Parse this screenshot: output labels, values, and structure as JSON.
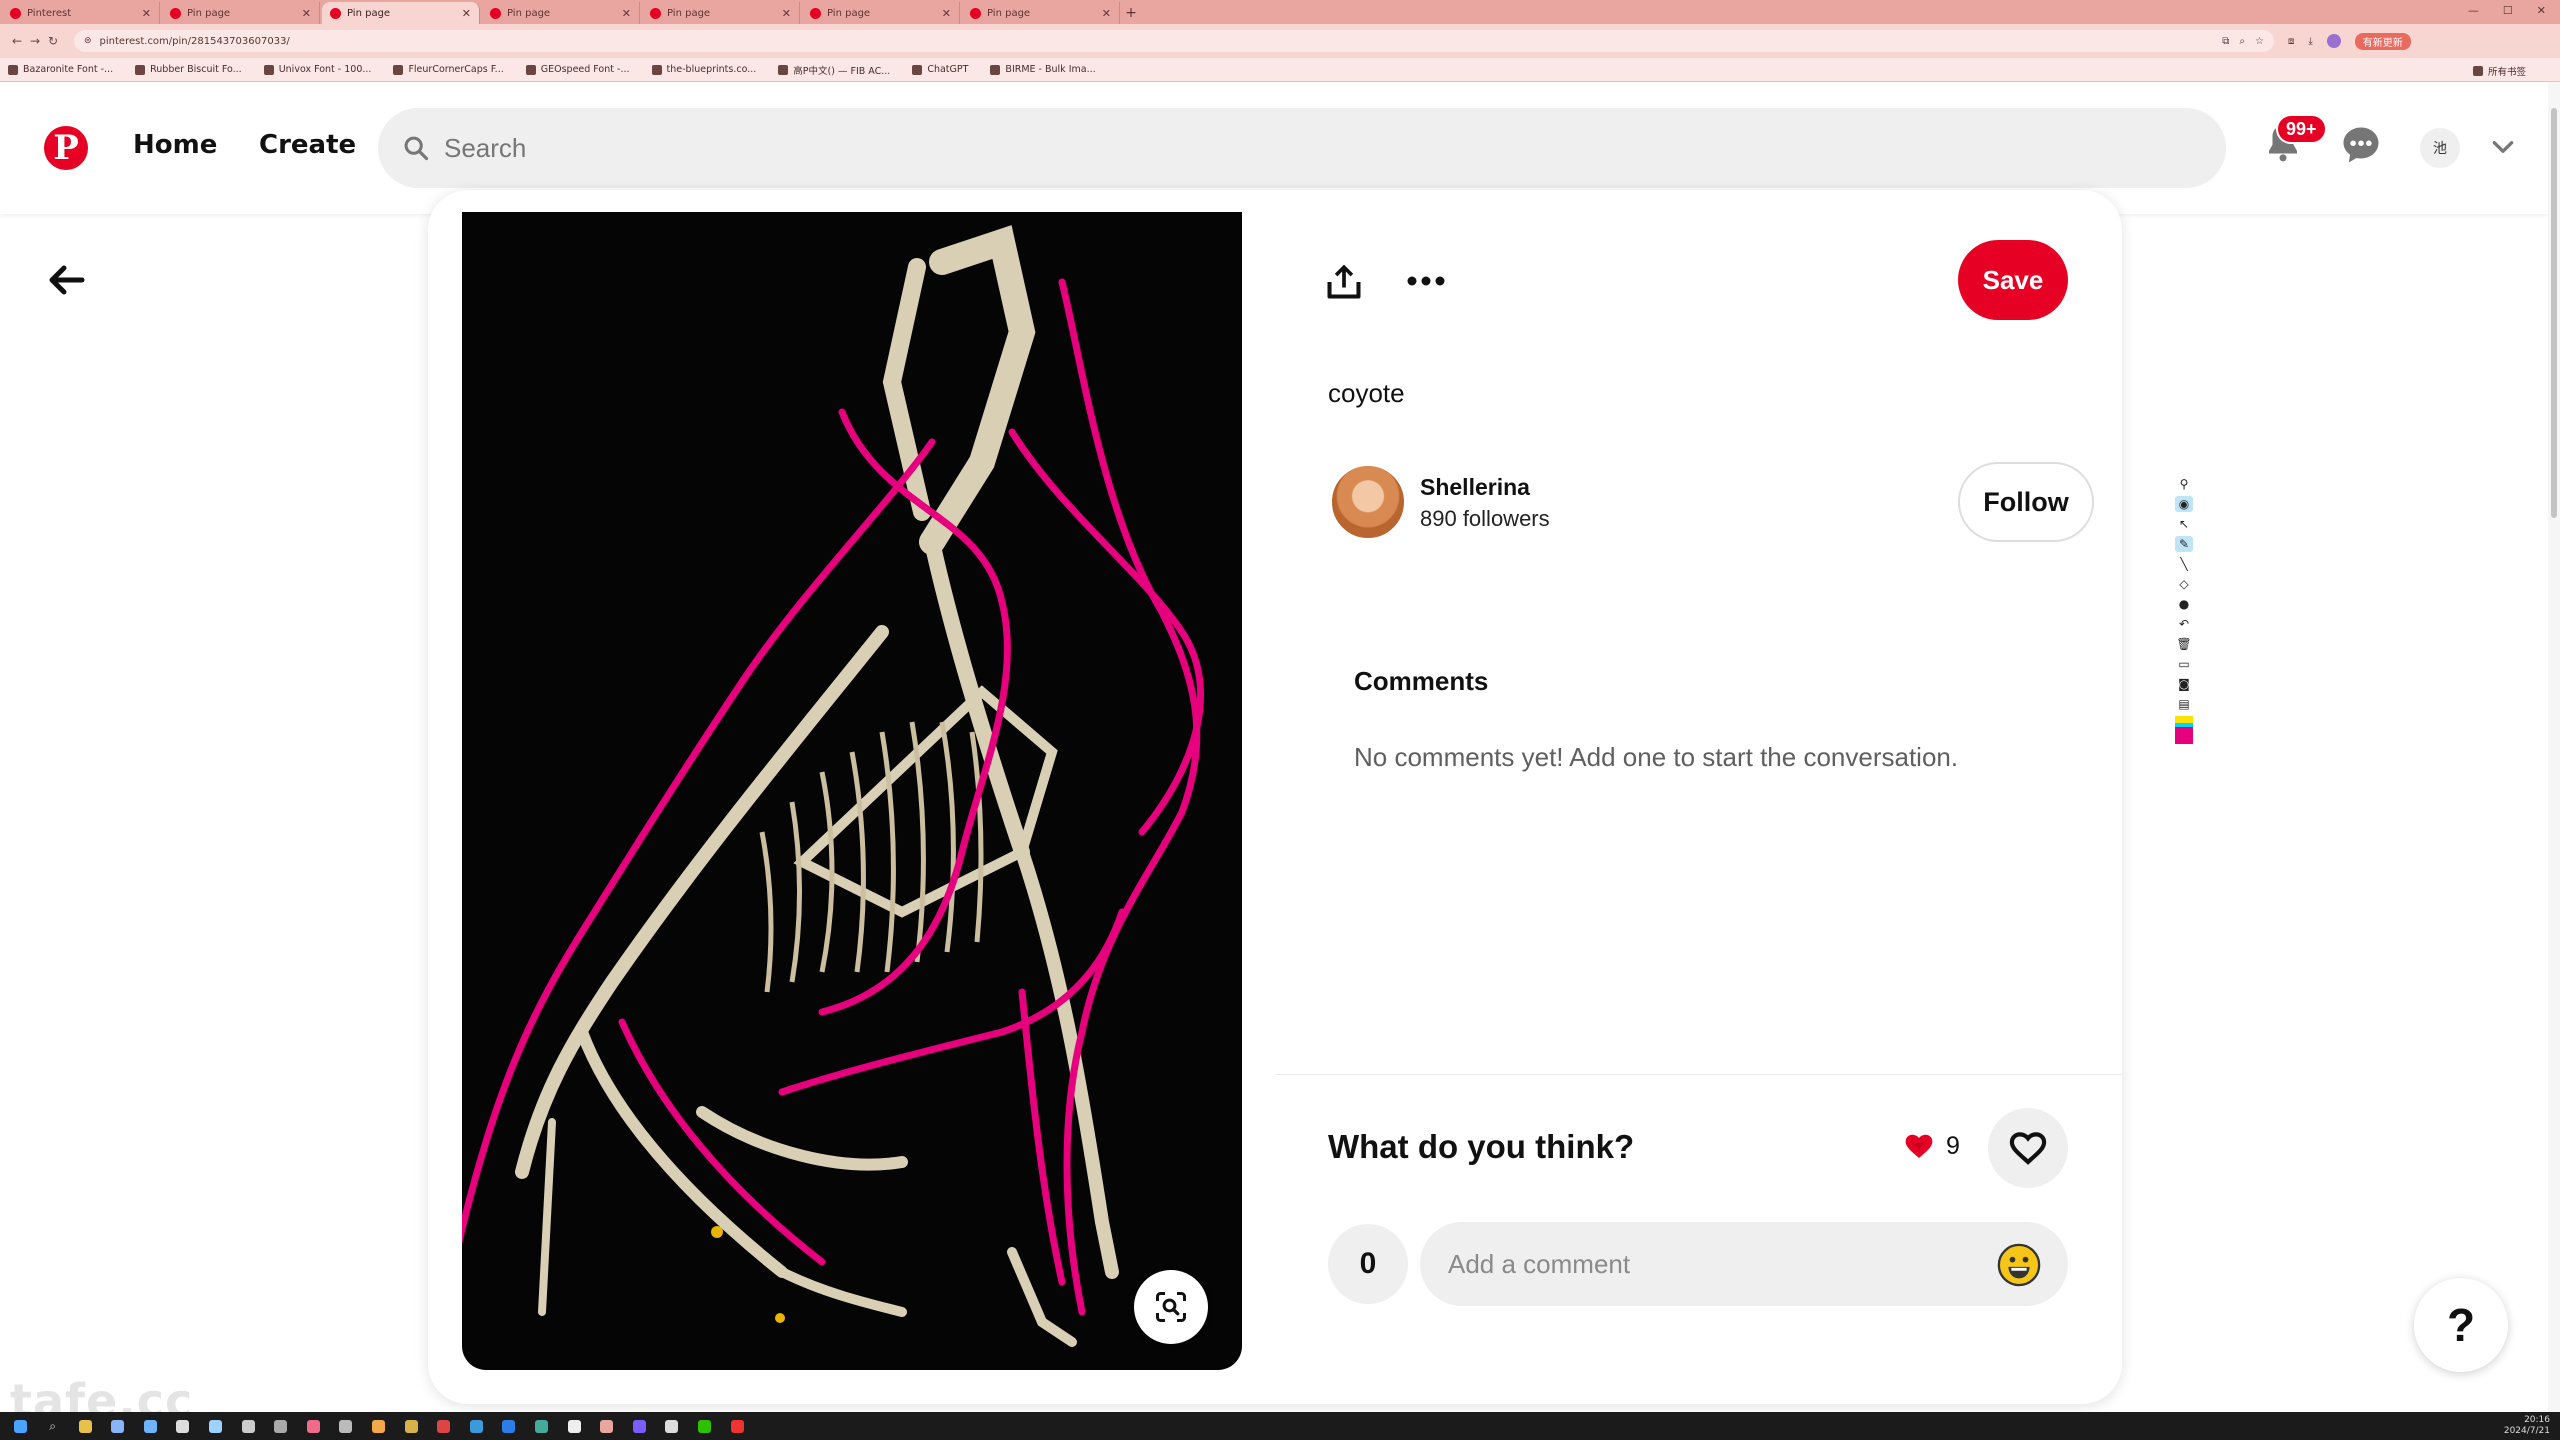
{
  "browser": {
    "tabs": [
      {
        "title": "Pinterest",
        "active": false
      },
      {
        "title": "Pin page",
        "active": false
      },
      {
        "title": "Pin page",
        "active": true
      },
      {
        "title": "Pin page",
        "active": false
      },
      {
        "title": "Pin page",
        "active": false
      },
      {
        "title": "Pin page",
        "active": false
      },
      {
        "title": "Pin page",
        "active": false
      }
    ],
    "url": "pinterest.com/pin/281543703607033/",
    "update_label": "有新更新",
    "bookmarks": [
      "Bazaronite Font -...",
      "Rubber Biscuit Fo...",
      "Univox Font - 100...",
      "FleurCornerCaps F...",
      "GEOspeed Font -...",
      "the-blueprints.co...",
      "高P中文() — FIB AC...",
      "ChatGPT",
      "BIRME - Bulk Ima..."
    ],
    "bookmarks_right": "所有书签"
  },
  "header": {
    "logo": "P",
    "nav": {
      "home": "Home",
      "create": "Create"
    },
    "search_placeholder": "Search",
    "notif_badge": "99+",
    "user_initial": "池",
    "brand_color": "#e60023"
  },
  "pin": {
    "title": "coyote",
    "save_label": "Save",
    "creator": {
      "name": "Shellerina",
      "followers": "890 followers"
    },
    "follow_label": "Follow",
    "comments_heading": "Comments",
    "comments_empty": "No comments yet! Add one to start the conversation.",
    "what_do_you_think": "What do you think?",
    "reaction_count": "9",
    "comment_count": "0",
    "comment_placeholder": "Add a comment",
    "image_alt": "Coyote skeleton with pink overlay sketch lines"
  },
  "help_label": "?",
  "watermark": "tafe.cc",
  "taskbar": {
    "time": "20:16",
    "date": "2024/7/21"
  },
  "icons": [
    "pinterest-logo-icon",
    "search-icon",
    "bell-icon",
    "chat-icon",
    "chevron-down-icon",
    "back-arrow-icon",
    "share-icon",
    "more-icon",
    "visual-search-icon",
    "heart-reaction-icon",
    "heart-outline-icon",
    "emoji-icon"
  ]
}
